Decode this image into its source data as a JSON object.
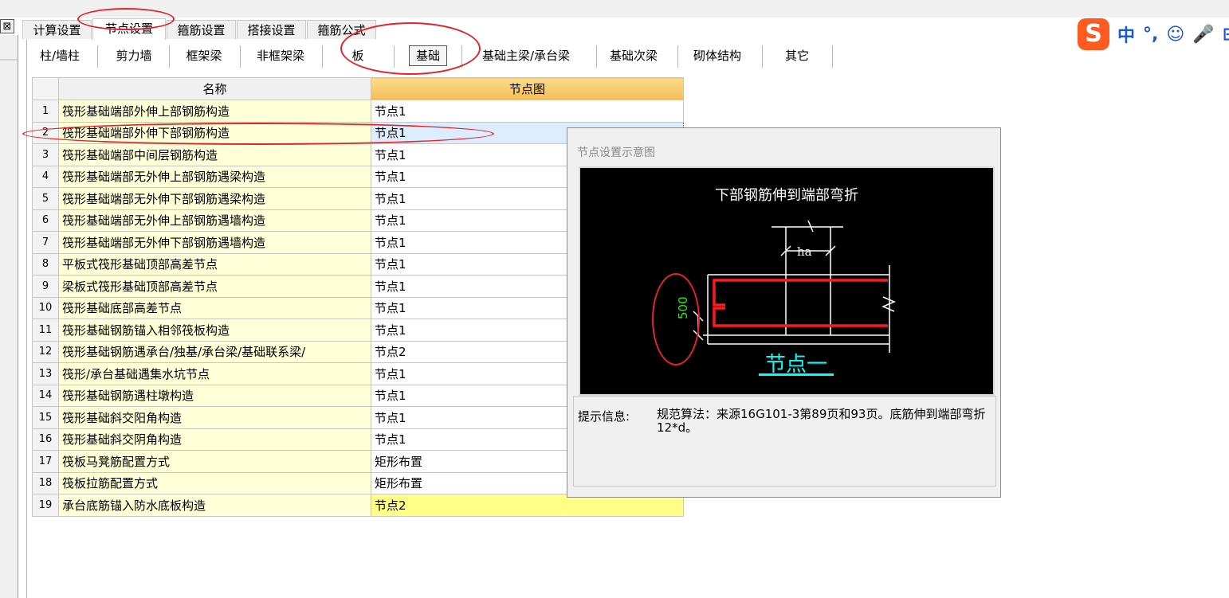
{
  "tabs": [
    "计算设置",
    "节点设置",
    "箍筋设置",
    "搭接设置",
    "箍筋公式"
  ],
  "active_tab": "节点设置",
  "close_glyph": "⊠",
  "subtabs": [
    "柱/墙柱",
    "剪力墙",
    "框架梁",
    "非框架梁",
    "板",
    "基础",
    "基础主梁/承台梁",
    "基础次梁",
    "砌体结构",
    "其它"
  ],
  "active_subtab": "基础",
  "grid": {
    "headers": {
      "name": "名称",
      "node": "节点图"
    },
    "rows": [
      {
        "num": "1",
        "name": "筏形基础端部外伸上部钢筋构造",
        "node": "节点1"
      },
      {
        "num": "2",
        "name": "筏形基础端部外伸下部钢筋构造",
        "node": "节点1"
      },
      {
        "num": "3",
        "name": "筏形基础端部中间层钢筋构造",
        "node": "节点1"
      },
      {
        "num": "4",
        "name": "筏形基础端部无外伸上部钢筋遇梁构造",
        "node": "节点1"
      },
      {
        "num": "5",
        "name": "筏形基础端部无外伸下部钢筋遇梁构造",
        "node": "节点1"
      },
      {
        "num": "6",
        "name": "筏形基础端部无外伸上部钢筋遇墙构造",
        "node": "节点1"
      },
      {
        "num": "7",
        "name": "筏形基础端部无外伸下部钢筋遇墙构造",
        "node": "节点1"
      },
      {
        "num": "8",
        "name": "平板式筏形基础顶部高差节点",
        "node": "节点1"
      },
      {
        "num": "9",
        "name": "梁板式筏形基础顶部高差节点",
        "node": "节点1"
      },
      {
        "num": "10",
        "name": "筏形基础底部高差节点",
        "node": "节点1"
      },
      {
        "num": "11",
        "name": "筏形基础钢筋锚入相邻筏板构造",
        "node": "节点1"
      },
      {
        "num": "12",
        "name": "筏形基础钢筋遇承台/独基/承台梁/基础联系梁/",
        "node": "节点2"
      },
      {
        "num": "13",
        "name": "筏形/承台基础遇集水坑节点",
        "node": "节点1"
      },
      {
        "num": "14",
        "name": "筏形基础钢筋遇柱墩构造",
        "node": "节点1"
      },
      {
        "num": "15",
        "name": "筏形基础斜交阳角构造",
        "node": "节点1"
      },
      {
        "num": "16",
        "name": "筏形基础斜交阴角构造",
        "node": "节点1"
      },
      {
        "num": "17",
        "name": "筏板马凳筋配置方式",
        "node": "矩形布置"
      },
      {
        "num": "18",
        "name": "筏板拉筋配置方式",
        "node": "矩形布置"
      },
      {
        "num": "19",
        "name": "承台底筋锚入防水底板构造",
        "node": "节点2"
      }
    ],
    "selected_row": "2",
    "highlighted_row": "19"
  },
  "popup": {
    "title": "节点设置示意图",
    "diagram_title": "下部钢筋伸到端部弯折",
    "dim_ha": "ha",
    "dim_500": "500",
    "diagram_label": "节点一",
    "info_label": "提示信息:",
    "info_text": "规范算法：来源16G101-3第89页和93页。底筋伸到端部弯折12*d。"
  },
  "ime": {
    "logo": "S",
    "items": [
      "中",
      "°,",
      "☺",
      "🎤",
      "⊞"
    ]
  },
  "colors": {
    "annotation": "#e3242b",
    "header_gold": "#f4be58",
    "name_cell": "#ffffd8",
    "rebar": "#ff0000",
    "label_cyan": "#00ffff"
  }
}
